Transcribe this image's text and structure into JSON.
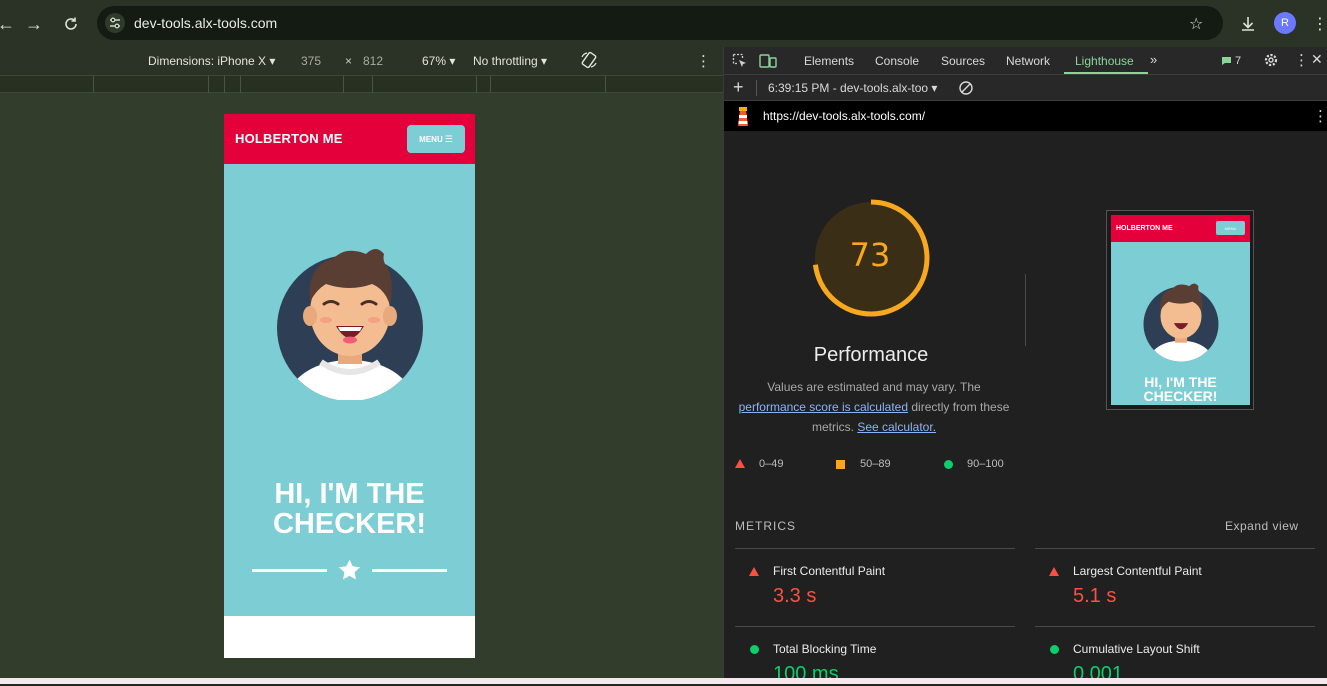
{
  "browser": {
    "url": "dev-tools.alx-tools.com",
    "avatar_letter": "R"
  },
  "device_toolbar": {
    "dimensions_label": "Dimensions: iPhone X",
    "width": "375",
    "times": "×",
    "height": "812",
    "zoom": "67%",
    "throttling": "No throttling"
  },
  "page": {
    "brand": "HOLBERTON ME",
    "menu_label": "MENU",
    "headline_line1": "HI, I'M THE",
    "headline_line2": "CHECKER!"
  },
  "devtools": {
    "tabs": [
      "Elements",
      "Console",
      "Sources",
      "Network",
      "Lighthouse"
    ],
    "issues_count": "7",
    "report_selector": "6:39:15 PM - dev-tools.alx-too",
    "report_url": "https://dev-tools.alx-tools.com/",
    "score": "73",
    "score_value": 73,
    "category": "Performance",
    "desc_part1": "Values are estimated and may vary. The",
    "desc_link1": "performance score is calculated",
    "desc_part2": "directly from these",
    "desc_part3": "metrics.",
    "desc_link2": "See calculator.",
    "legend": [
      "0–49",
      "50–89",
      "90–100"
    ],
    "metrics_heading": "METRICS",
    "expand_view": "Expand view",
    "metrics": [
      {
        "label": "First Contentful Paint",
        "value": "3.3 s"
      },
      {
        "label": "Largest Contentful Paint",
        "value": "5.1 s"
      },
      {
        "label": "Total Blocking Time",
        "value": "100 ms"
      },
      {
        "label": "Cumulative Layout Shift",
        "value": "0.001"
      }
    ],
    "thumbnail": {
      "brand": "HOLBERTON ME",
      "menu": "MENU",
      "line1": "HI, I'M THE",
      "line2": "CHECKER!"
    }
  },
  "colors": {
    "brand_red": "#e4003b",
    "teal": "#7ccdd4",
    "score_orange": "#f7a81e",
    "fail_red": "#ff4e42",
    "pass_green": "#0cce6b",
    "active_tab_green": "#8ad49a"
  }
}
